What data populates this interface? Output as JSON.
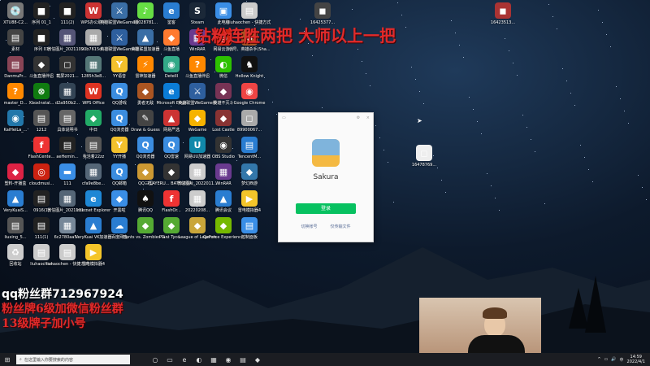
{
  "overlays": {
    "top_banner": "钻粉连胜两把 大师以上一把",
    "qq_group": "qq粉丝群712967924",
    "fan_badge": "粉丝牌6级加微信粉丝群",
    "brand": "13级牌子加小号"
  },
  "icons": [
    {
      "label": "XTU88-C2...",
      "glyph": "💿",
      "color": "#777"
    },
    {
      "label": "序列 01_1",
      "glyph": "■",
      "color": "#222"
    },
    {
      "label": "111(2)",
      "glyph": "■",
      "color": "#222"
    },
    {
      "label": "WPS办公助手",
      "glyph": "W",
      "color": "#c33"
    },
    {
      "label": "英雄联盟WeGame版",
      "glyph": "⚔",
      "color": "#3a6ea5"
    },
    {
      "label": "10028781...",
      "glyph": "♪",
      "color": "#6d4"
    },
    {
      "label": "鉴客",
      "glyph": "e",
      "color": "#2a7dd1"
    },
    {
      "label": "Steam",
      "glyph": "S",
      "color": "#1b2838"
    },
    {
      "label": "此电脑",
      "glyph": "▣",
      "color": "#3a8ee6"
    },
    {
      "label": "liuhaochen - 快捷方式",
      "glyph": "▤",
      "color": "#ccc"
    },
    {
      "label": "16425377...",
      "glyph": "◼",
      "color": "#444"
    },
    {
      "label": "16423513...",
      "glyph": "◼",
      "color": "#a33"
    },
    {
      "label": "素材",
      "glyph": "▤",
      "color": "#444"
    },
    {
      "label": "序列 01",
      "glyph": "■",
      "color": "#222"
    },
    {
      "label": "微信图片_2021102...",
      "glyph": "▦",
      "color": "#557"
    },
    {
      "label": "90b7615d...",
      "glyph": "▦",
      "color": "#aaa"
    },
    {
      "label": "英雄联盟WeGame版",
      "glyph": "⚔",
      "color": "#2e5f9e"
    },
    {
      "label": "英雄联盟加速器",
      "glyph": "▲",
      "color": "#3a6ea5"
    },
    {
      "label": "斗鱼直播",
      "glyph": "◆",
      "color": "#ff7a2f"
    },
    {
      "label": "WinRAR",
      "glyph": "▦",
      "color": "#6a3a8f"
    },
    {
      "label": "网易云游戏",
      "glyph": "◎",
      "color": "#c21"
    },
    {
      "label": "小号、英雄杀手(Sha...",
      "glyph": "◆",
      "color": "#a52"
    },
    {
      "label": "DanmuPr...",
      "glyph": "▤",
      "color": "#845"
    },
    {
      "label": "斗鱼直播伴侣",
      "glyph": "◆",
      "color": "#333"
    },
    {
      "label": "截屏2021...",
      "glyph": "◻",
      "color": "#333"
    },
    {
      "label": "1285h3e8...",
      "glyph": "▦",
      "color": "#577"
    },
    {
      "label": "YY语音",
      "glyph": "Y",
      "color": "#f3c12c"
    },
    {
      "label": "雷神加速器",
      "glyph": "⚡",
      "color": "#ff8800"
    },
    {
      "label": "DetellI",
      "glyph": "◉",
      "color": "#3a8"
    },
    {
      "label": "斗鱼直播伴侣",
      "glyph": "?",
      "color": "#f80"
    },
    {
      "label": "微信",
      "glyph": "◐",
      "color": "#2dc100"
    },
    {
      "label": "Hollow Knight",
      "glyph": "♞",
      "color": "#111"
    },
    {
      "label": "master_D...",
      "glyph": "?",
      "color": "#f80"
    },
    {
      "label": "XboxInstal...",
      "glyph": "⊗",
      "color": "#107c10"
    },
    {
      "label": "d2a950b2...",
      "glyph": "▦",
      "color": "#345"
    },
    {
      "label": "WPS Office",
      "glyph": "W",
      "color": "#d32"
    },
    {
      "label": "QQ游戏",
      "glyph": "Q",
      "color": "#3b8de0"
    },
    {
      "label": "勇者无敌",
      "glyph": "◆",
      "color": "#a52"
    },
    {
      "label": "Microsoft Edge",
      "glyph": "e",
      "color": "#0b7cd6"
    },
    {
      "label": "英雄联盟WeGame版",
      "glyph": "⚔",
      "color": "#2e5f9e"
    },
    {
      "label": "英雄不灭斗",
      "glyph": "◆",
      "color": "#735"
    },
    {
      "label": "Google Chrome",
      "glyph": "◉",
      "color": "#e44"
    },
    {
      "label": "KaiHeiLa_...",
      "glyph": "◉",
      "color": "#27a"
    },
    {
      "label": "1212",
      "glyph": "▤",
      "color": "#555"
    },
    {
      "label": "具体说明书",
      "glyph": "▤",
      "color": "#666"
    },
    {
      "label": "中日",
      "glyph": "◆",
      "color": "#2a6"
    },
    {
      "label": "QQ浏览器",
      "glyph": "Q",
      "color": "#3b8de0"
    },
    {
      "label": "Draw & Guess",
      "glyph": "✎",
      "color": "#444"
    },
    {
      "label": "网易严选",
      "glyph": "▲",
      "color": "#c33"
    },
    {
      "label": "WeGame",
      "glyph": "◆",
      "color": "#f6b300"
    },
    {
      "label": "Lost Castle",
      "glyph": "◆",
      "color": "#833"
    },
    {
      "label": "89900067...",
      "glyph": "◻",
      "color": "#aaa"
    },
    {
      "label": "16478769...",
      "glyph": "◻",
      "color": "#eee"
    },
    {
      "label": "FlashCente...",
      "glyph": "f",
      "color": "#e33"
    },
    {
      "label": "aeHemin...",
      "glyph": "▤",
      "color": "#222"
    },
    {
      "label": "我活着22zz",
      "glyph": "▤",
      "color": "#555"
    },
    {
      "label": "YY开播",
      "glyph": "Y",
      "color": "#f3c12c"
    },
    {
      "label": "QQ浏览器",
      "glyph": "Q",
      "color": "#3b8de0"
    },
    {
      "label": "QQ雷速",
      "glyph": "Q",
      "color": "#3b8de0"
    },
    {
      "label": "网易UU加速器",
      "glyph": "U",
      "color": "#18a"
    },
    {
      "label": "OBS Studio",
      "glyph": "◉",
      "color": "#333"
    },
    {
      "label": "TencentM...",
      "glyph": "▤",
      "color": "#2a7dd1"
    },
    {
      "label": "塑料-开播盒",
      "glyph": "◆",
      "color": "#d24"
    },
    {
      "label": "cloudmusi...",
      "glyph": "◎",
      "color": "#c21"
    },
    {
      "label": "111",
      "glyph": "▬",
      "color": "#3a8ee6"
    },
    {
      "label": "cfa9e8be...",
      "glyph": "▦",
      "color": "#567"
    },
    {
      "label": "QQ邮箱",
      "glyph": "Q",
      "color": "#3b8de0"
    },
    {
      "label": "QQ三国",
      "glyph": "◆",
      "color": "#c93"
    },
    {
      "label": "PLAYERU... BATTLEGR...",
      "glyph": "◆",
      "color": "#333"
    },
    {
      "label": "微信图片_2022011...",
      "glyph": "▦",
      "color": "#ccc"
    },
    {
      "label": "WinRAR",
      "glyph": "▦",
      "color": "#6a3a8f"
    },
    {
      "label": "梦幻西游",
      "glyph": "◆",
      "color": "#37a"
    },
    {
      "label": "VeryKuaiS...",
      "glyph": "▲",
      "color": "#2a7dd1"
    },
    {
      "label": "0916(1)",
      "glyph": "▤",
      "color": "#222"
    },
    {
      "label": "微信图片_2021111...",
      "glyph": "▦",
      "color": "#567"
    },
    {
      "label": "Internet Explorer",
      "glyph": "e",
      "color": "#1e87d5"
    },
    {
      "label": "开黑啦",
      "glyph": "◆",
      "color": "#3a8ee6"
    },
    {
      "label": "腾讯QQ",
      "glyph": "♠",
      "color": "#111"
    },
    {
      "label": "FlashOr...",
      "glyph": "f",
      "color": "#e33"
    },
    {
      "label": "20220208...",
      "glyph": "▦",
      "color": "#ccc"
    },
    {
      "label": "腾讯会议",
      "glyph": "▲",
      "color": "#2a7dd1"
    },
    {
      "label": "雷电模拟器4",
      "glyph": "▶",
      "color": "#f4c52a"
    },
    {
      "label": "liuxing_5...",
      "glyph": "▤",
      "color": "#555"
    },
    {
      "label": "111(1)",
      "glyph": "▤",
      "color": "#222"
    },
    {
      "label": "6c2780aa5...",
      "glyph": "▦",
      "color": "#789"
    },
    {
      "label": "VeryKuai VK加速器",
      "glyph": "▲",
      "color": "#2a7dd1"
    },
    {
      "label": "百度网盘",
      "glyph": "☁",
      "color": "#2a7dd1"
    },
    {
      "label": "Plants vs. Zombies G...",
      "glyph": "◆",
      "color": "#5a3"
    },
    {
      "label": "Plant Tyco...",
      "glyph": "◆",
      "color": "#5a3"
    },
    {
      "label": "League of Legends",
      "glyph": "◆",
      "color": "#c9a63a"
    },
    {
      "label": "GeForce Experience",
      "glyph": "◆",
      "color": "#76b900"
    },
    {
      "label": "控制面板",
      "glyph": "▤",
      "color": "#3a8ee6"
    },
    {
      "label": "回收站",
      "glyph": "♻",
      "color": "#ccc"
    },
    {
      "label": "liuhaochen",
      "glyph": "▤",
      "color": "#ccc"
    },
    {
      "label": "liuhaochen - 快捷方式",
      "glyph": "▤",
      "color": "#ccc"
    },
    {
      "label": "雷电模拟器4",
      "glyph": "▶",
      "color": "#f4c52a"
    }
  ],
  "dialog": {
    "app_name": "Sakura",
    "login_label": "登录",
    "switch_account": "切换帐号",
    "transfer_files": "仅传输文件",
    "titlebar_gear": "⚙",
    "titlebar_close": "×"
  },
  "taskbar": {
    "start_icon": "⊞",
    "search_placeholder": "在这里输入你要搜索的内容",
    "pinned": [
      "○",
      "▭",
      "e",
      "◐",
      "▦",
      "◉",
      "▤",
      "◆"
    ],
    "clock_time": "14:59",
    "clock_date": "2022/4/1",
    "tray": [
      "^",
      "▭",
      "🔊",
      "中"
    ]
  }
}
